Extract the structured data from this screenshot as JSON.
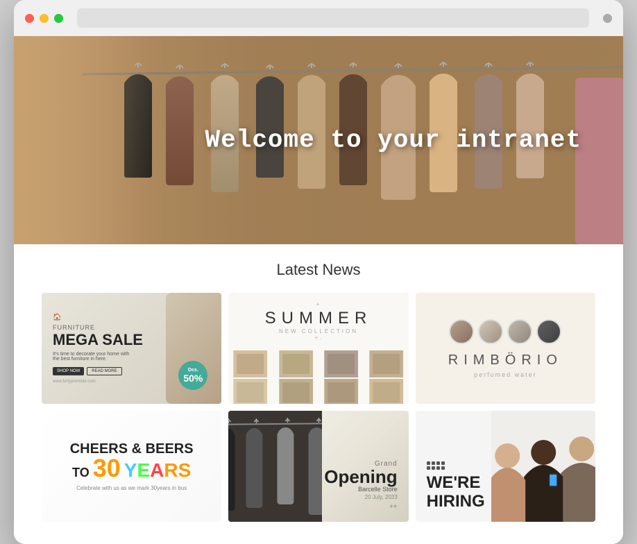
{
  "browser": {
    "dots": [
      "red",
      "yellow",
      "green"
    ],
    "menu_dot": "menu"
  },
  "hero": {
    "title": "Welcome to your intranet"
  },
  "news": {
    "section_title": "Latest News",
    "cards": [
      {
        "id": "furniture",
        "type": "Furniture Mega Sale",
        "subtitle": "FURNITURE",
        "title": "MEGA SALE",
        "description": "It's time to decorate your home with the best furniture in here.",
        "btn1": "SHOP NOW",
        "btn2": "READ MORE",
        "discount_label": "Dcs.",
        "discount_value": "50%",
        "url": "www.furlypremiole.com"
      },
      {
        "id": "summer",
        "type": "Summer Collection",
        "decorator_top": "+",
        "title": "SUMMER",
        "subtitle": "NEW COLLECTION",
        "decorator_bottom": "+."
      },
      {
        "id": "rimborio",
        "type": "Rimborio Perfume",
        "logo": "RIMBÖRIO",
        "tagline": "perfumed water"
      },
      {
        "id": "cheers",
        "type": "Cheers & Beers",
        "line1": "CHEERS",
        "amp": "&",
        "beers": "BEERS",
        "line2": "TO",
        "number": "30",
        "word": "YEARS",
        "tagline": "Celebrate with us as we mark 30years in bus"
      },
      {
        "id": "grand-opening",
        "type": "Grand Opening",
        "label": "Grand",
        "title": "Opening",
        "store": "Barcelle Store",
        "date": "20 July, 2023",
        "plus": "++"
      },
      {
        "id": "hiring",
        "type": "We're Hiring",
        "title": "WE'RE\nHIRING"
      }
    ]
  }
}
